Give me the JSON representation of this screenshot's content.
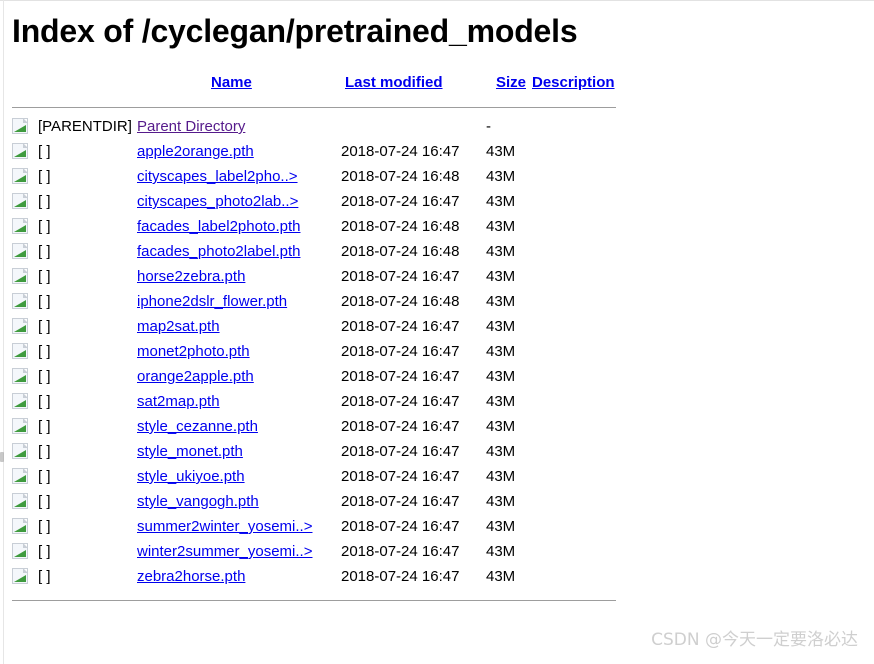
{
  "page": {
    "title": "Index of /cyclegan/pretrained_models"
  },
  "table": {
    "headers": {
      "name": "Name",
      "last_modified": "Last modified",
      "size": "Size",
      "description": "Description"
    },
    "parent": {
      "icon": "broken-image-icon",
      "type_label": "[PARENTDIR]",
      "name": "Parent Directory",
      "date": "",
      "size": "-",
      "description": ""
    },
    "rows": [
      {
        "icon": "broken-image-icon",
        "type_label": "[ ]",
        "name": "apple2orange.pth",
        "date": "2018-07-24 16:47",
        "size": "43M",
        "description": ""
      },
      {
        "icon": "broken-image-icon",
        "type_label": "[ ]",
        "name": "cityscapes_label2pho..>",
        "date": "2018-07-24 16:48",
        "size": "43M",
        "description": ""
      },
      {
        "icon": "broken-image-icon",
        "type_label": "[ ]",
        "name": "cityscapes_photo2lab..>",
        "date": "2018-07-24 16:47",
        "size": "43M",
        "description": ""
      },
      {
        "icon": "broken-image-icon",
        "type_label": "[ ]",
        "name": "facades_label2photo.pth",
        "date": "2018-07-24 16:48",
        "size": "43M",
        "description": ""
      },
      {
        "icon": "broken-image-icon",
        "type_label": "[ ]",
        "name": "facades_photo2label.pth",
        "date": "2018-07-24 16:48",
        "size": "43M",
        "description": ""
      },
      {
        "icon": "broken-image-icon",
        "type_label": "[ ]",
        "name": "horse2zebra.pth",
        "date": "2018-07-24 16:47",
        "size": "43M",
        "description": ""
      },
      {
        "icon": "broken-image-icon",
        "type_label": "[ ]",
        "name": "iphone2dslr_flower.pth",
        "date": "2018-07-24 16:48",
        "size": "43M",
        "description": ""
      },
      {
        "icon": "broken-image-icon",
        "type_label": "[ ]",
        "name": "map2sat.pth",
        "date": "2018-07-24 16:47",
        "size": "43M",
        "description": ""
      },
      {
        "icon": "broken-image-icon",
        "type_label": "[ ]",
        "name": "monet2photo.pth",
        "date": "2018-07-24 16:47",
        "size": "43M",
        "description": ""
      },
      {
        "icon": "broken-image-icon",
        "type_label": "[ ]",
        "name": "orange2apple.pth",
        "date": "2018-07-24 16:47",
        "size": "43M",
        "description": ""
      },
      {
        "icon": "broken-image-icon",
        "type_label": "[ ]",
        "name": "sat2map.pth",
        "date": "2018-07-24 16:47",
        "size": "43M",
        "description": ""
      },
      {
        "icon": "broken-image-icon",
        "type_label": "[ ]",
        "name": "style_cezanne.pth",
        "date": "2018-07-24 16:47",
        "size": "43M",
        "description": ""
      },
      {
        "icon": "broken-image-icon",
        "type_label": "[ ]",
        "name": "style_monet.pth",
        "date": "2018-07-24 16:47",
        "size": "43M",
        "description": ""
      },
      {
        "icon": "broken-image-icon",
        "type_label": "[ ]",
        "name": "style_ukiyoe.pth",
        "date": "2018-07-24 16:47",
        "size": "43M",
        "description": ""
      },
      {
        "icon": "broken-image-icon",
        "type_label": "[ ]",
        "name": "style_vangogh.pth",
        "date": "2018-07-24 16:47",
        "size": "43M",
        "description": ""
      },
      {
        "icon": "broken-image-icon",
        "type_label": "[ ]",
        "name": "summer2winter_yosemi..>",
        "date": "2018-07-24 16:47",
        "size": "43M",
        "description": ""
      },
      {
        "icon": "broken-image-icon",
        "type_label": "[ ]",
        "name": "winter2summer_yosemi..>",
        "date": "2018-07-24 16:47",
        "size": "43M",
        "description": ""
      },
      {
        "icon": "broken-image-icon",
        "type_label": "[ ]",
        "name": "zebra2horse.pth",
        "date": "2018-07-24 16:47",
        "size": "43M",
        "description": ""
      }
    ]
  },
  "watermark": {
    "text": "CSDN @今天一定要洛必达"
  },
  "colors": {
    "link": "#0000ee",
    "visited_link": "#551a8b",
    "text": "#000000",
    "rule": "#9d9d9d",
    "watermark": "#cfcfcf",
    "background": "#ffffff"
  }
}
